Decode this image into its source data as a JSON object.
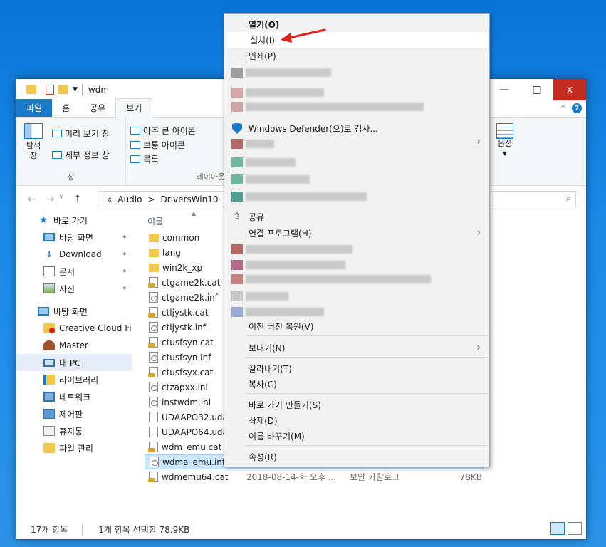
{
  "window": {
    "title": "wdm",
    "buttons": {
      "minimize": "—",
      "maximize": "□",
      "close": "x"
    }
  },
  "ribbon": {
    "tabs": [
      "파일",
      "홈",
      "공유",
      "보기"
    ],
    "pane_group": {
      "nav_pane_label": "탐색\n창",
      "preview_label": "미리 보기 창",
      "details_label": "세부 정보 창",
      "group_label": "창"
    },
    "layout_group": {
      "items": [
        "아주 큰 아이콘",
        "보통 아이콘",
        "목록"
      ],
      "group_label": "레이아웃"
    },
    "options_label": "옵션"
  },
  "address": {
    "crumbs": [
      "«",
      "Audio",
      ">",
      "DriversWin10",
      ">"
    ],
    "search_icon": "search-icon"
  },
  "nav_pane": {
    "items": [
      {
        "label": "바로 가기",
        "icon": "star-icon",
        "indent": 1
      },
      {
        "label": "바탕 화면",
        "icon": "monitor-icon",
        "pinned": true
      },
      {
        "label": "Download",
        "icon": "download-icon",
        "pinned": true
      },
      {
        "label": "문서",
        "icon": "document-icon",
        "pinned": true
      },
      {
        "label": "사진",
        "icon": "picture-icon",
        "pinned": true
      },
      {
        "label": "바탕 화면",
        "icon": "monitor-icon",
        "indent": 1
      },
      {
        "label": "Creative Cloud Files",
        "icon": "creative-cloud-icon"
      },
      {
        "label": "Master",
        "icon": "user-icon"
      },
      {
        "label": "내 PC",
        "icon": "pc-icon",
        "selected": true
      },
      {
        "label": "라이브러리",
        "icon": "library-icon"
      },
      {
        "label": "네트워크",
        "icon": "network-icon"
      },
      {
        "label": "제어판",
        "icon": "control-panel-icon"
      },
      {
        "label": "휴지통",
        "icon": "recycle-bin-icon"
      },
      {
        "label": "파일 관리",
        "icon": "folder-icon"
      }
    ]
  },
  "file_list": {
    "column_name": "이름",
    "files": [
      {
        "name": "common",
        "kind": "folder"
      },
      {
        "name": "lang",
        "kind": "folder"
      },
      {
        "name": "win2k_xp",
        "kind": "folder"
      },
      {
        "name": "ctgame2k.cat",
        "kind": "cat"
      },
      {
        "name": "ctgame2k.inf",
        "kind": "inf"
      },
      {
        "name": "ctljystk.cat",
        "kind": "cat"
      },
      {
        "name": "ctljystk.inf",
        "kind": "inf"
      },
      {
        "name": "ctusfsyn.cat",
        "kind": "cat"
      },
      {
        "name": "ctusfsyn.inf",
        "kind": "inf"
      },
      {
        "name": "ctusfsyx.cat",
        "kind": "cat"
      },
      {
        "name": "ctzapxx.ini",
        "kind": "inf"
      },
      {
        "name": "instwdm.ini",
        "kind": "inf"
      },
      {
        "name": "UDAAPO32.uda",
        "kind": "file"
      },
      {
        "name": "UDAAPO64.uda",
        "kind": "file"
      },
      {
        "name": "wdm_emu.cat",
        "kind": "cat"
      },
      {
        "name": "wdma_emu.inf",
        "kind": "inf",
        "selected": true,
        "size": "79KB"
      },
      {
        "name": "wdmemu64.cat",
        "kind": "cat",
        "date": "2018-08-14-화 오후 ...",
        "type": "보안 카탈로그",
        "size": "78KB"
      }
    ]
  },
  "status": {
    "count": "17개 항목",
    "selection": "1개 항목 선택함 78.9KB"
  },
  "context_menu": {
    "open": "열기(O)",
    "install": "설치(I)",
    "print": "인쇄(P)",
    "defender": "Windows Defender(으)로 검사...",
    "share": "공유",
    "open_with": "연결 프로그램(H)",
    "restore": "이전 버전 복원(V)",
    "send_to": "보내기(N)",
    "cut": "잘라내기(T)",
    "copy": "복사(C)",
    "shortcut": "바로 가기 만들기(S)",
    "delete": "삭제(D)",
    "rename": "이름 바꾸기(M)",
    "properties": "속성(R)"
  },
  "colors": {
    "accent": "#1979ca",
    "annotation_arrow": "#e0201b"
  }
}
